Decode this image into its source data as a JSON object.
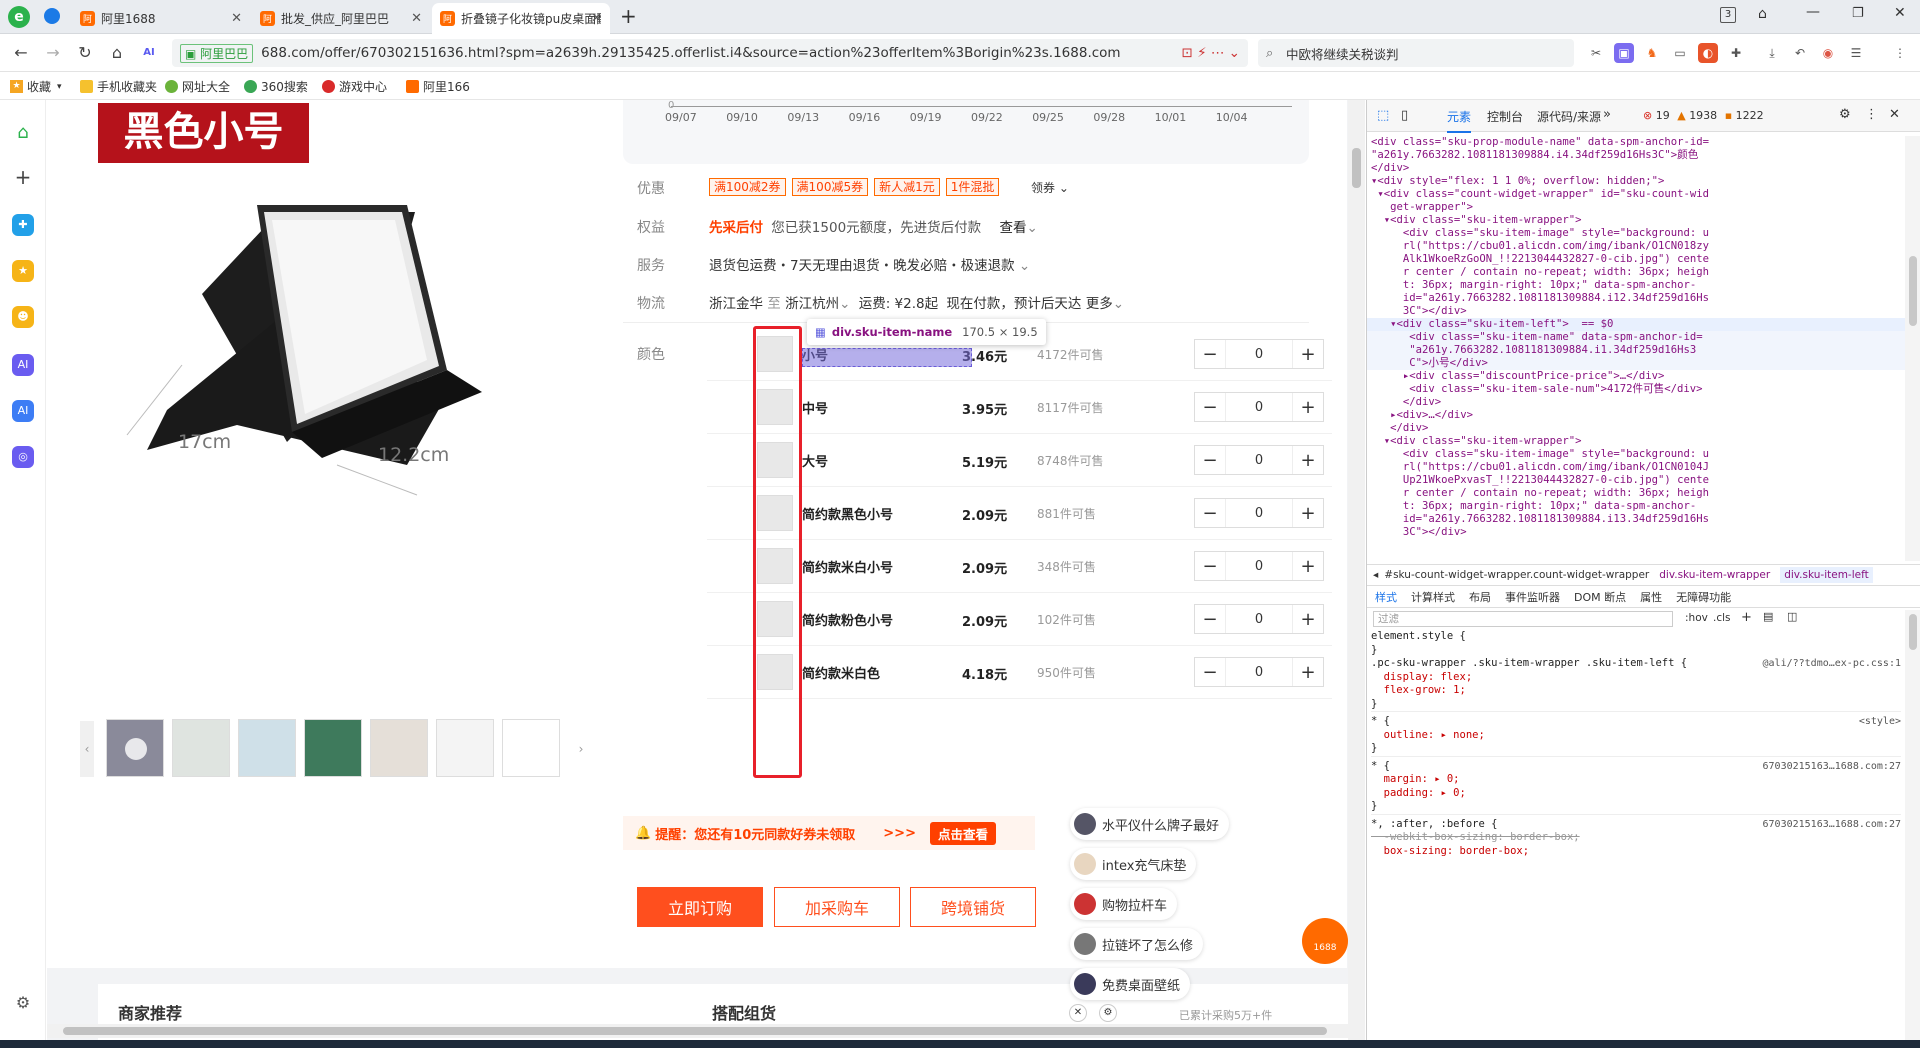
{
  "browser": {
    "tabs": [
      {
        "label": "阿里1688"
      },
      {
        "label": "批发_供应_阿里巴巴"
      },
      {
        "label": "折叠镜子化妆镜pu皮桌面翻盖"
      }
    ],
    "tab_count": "3",
    "url_site": "阿里巴巴",
    "url": "688.com/offer/670302151636.html?spm=a2639h.29135425.offerlist.i4&source=action%23offerItem%3Borigin%23s.1688.com",
    "search_text": "中欧将继续关税谈判",
    "bookmarks": [
      "收藏",
      "手机收藏夹",
      "网址大全",
      "360搜索",
      "游戏中心",
      "阿里166"
    ]
  },
  "product": {
    "variant_banner": "黑色小号",
    "dim_width": "17cm",
    "dim_height": "12.2cm",
    "chart_dates": [
      "09/07",
      "09/10",
      "09/13",
      "09/16",
      "09/19",
      "09/22",
      "09/25",
      "09/28",
      "10/01",
      "10/04"
    ],
    "chart_zero": "0",
    "youhui_label": "优惠",
    "promos": [
      "满100减2券",
      "满100减5券",
      "新人减1元",
      "1件混批"
    ],
    "coupon_link": "领券",
    "quanyi_label": "权益",
    "quanyi_strong": "先采后付",
    "quanyi_text": "您已获1500元额度，先进货后付款",
    "quanyi_link": "查看",
    "fuwu_label": "服务",
    "fuwu_text": "退货包运费・7天无理由退货・晚发必赔・极速退款",
    "wuliu_label": "物流",
    "wuliu_from": "浙江金华",
    "wuliu_to_word": "至",
    "wuliu_to": "浙江杭州",
    "wuliu_fee": "运费: ¥2.8起",
    "wuliu_eta": "现在付款，预计后天达",
    "wuliu_more": "更多",
    "color_label": "颜色",
    "tooltip_name": "div.sku-item-name",
    "tooltip_size": "170.5 × 19.5",
    "skus": [
      {
        "name": "小号",
        "price": "3.46元",
        "stock": "4172件可售",
        "qty": "0"
      },
      {
        "name": "中号",
        "price": "3.95元",
        "stock": "8117件可售",
        "qty": "0"
      },
      {
        "name": "大号",
        "price": "5.19元",
        "stock": "8748件可售",
        "qty": "0"
      },
      {
        "name": "简约款黑色小号",
        "price": "2.09元",
        "stock": "881件可售",
        "qty": "0"
      },
      {
        "name": "简约款米白小号",
        "price": "2.09元",
        "stock": "348件可售",
        "qty": "0"
      },
      {
        "name": "简约款粉色小号",
        "price": "2.09元",
        "stock": "102件可售",
        "qty": "0"
      },
      {
        "name": "简约款米白色",
        "price": "4.18元",
        "stock": "950件可售",
        "qty": "0"
      }
    ],
    "minus": "−",
    "plus": "+",
    "reminder_text": "提醒：您还有10元同款好券未领取",
    "reminder_arrows": ">>>",
    "reminder_btn": "点击查看",
    "btn_order": "立即订购",
    "btn_cart": "加采购车",
    "btn_cross": "跨境铺货",
    "section_left": "商家推荐",
    "section_right": "搭配组货",
    "float_items": [
      "水平仪什么牌子最好",
      "intex充气床垫",
      "购物拉杆车",
      "拉链坏了怎么修",
      "免费桌面壁纸"
    ],
    "bottom_note": "已累计采购5万+件",
    "logo_text": "1688"
  },
  "devtools": {
    "tabs": [
      "元素",
      "控制台",
      "源代码/来源"
    ],
    "errors": "19",
    "warnings": "1938",
    "info": "1222",
    "code_lines": [
      "<div class=\"sku-prop-module-name\" data-spm-anchor-id=",
      "\"a261y.7663282.1081181309884.i4.34df259d16Hs3C\">颜色",
      "</div>",
      "▾<div style=\"flex: 1 1 0%; overflow: hidden;\">",
      " ▾<div class=\"count-widget-wrapper\" id=\"sku-count-wid",
      "   get-wrapper\">",
      "  ▾<div class=\"sku-item-wrapper\">",
      "     <div class=\"sku-item-image\" style=\"background: u",
      "     rl(\"https://cbu01.alicdn.com/img/ibank/O1CN018zy",
      "     Alk1WkoeRzGoON_!!2213044432827-0-cib.jpg\") cente",
      "     r center / contain no-repeat; width: 36px; heigh",
      "     t: 36px; margin-right: 10px;\" data-spm-anchor-",
      "     id=\"a261y.7663282.1081181309884.i12.34df259d16Hs",
      "     3C\"></div>",
      "   ▾<div class=\"sku-item-left\">  == $0",
      "      <div class=\"sku-item-name\" data-spm-anchor-id=",
      "      \"a261y.7663282.1081181309884.i1.34df259d16Hs3",
      "      C\">小号</div>",
      "     ▸<div class=\"discountPrice-price\">…</div>",
      "      <div class=\"sku-item-sale-num\">4172件可售</div>",
      "     </div>",
      "   ▸<div>…</div>",
      "   </div>",
      "  ▾<div class=\"sku-item-wrapper\">",
      "     <div class=\"sku-item-image\" style=\"background: u",
      "     rl(\"https://cbu01.alicdn.com/img/ibank/O1CN0104J",
      "     Up21WkoePxvasT_!!2213044432827-0-cib.jpg\") cente",
      "     r center / contain no-repeat; width: 36px; heigh",
      "     t: 36px; margin-right: 10px;\" data-spm-anchor-",
      "     id=\"a261y.7663282.1081181309884.i13.34df259d16Hs",
      "     3C\"></div>"
    ],
    "breadcrumb": [
      "#sku-count-widget-wrapper.count-widget-wrapper",
      "div.sku-item-wrapper",
      "div.sku-item-left"
    ],
    "subtabs": [
      "样式",
      "计算样式",
      "布局",
      "事件监听器",
      "DOM 断点",
      "属性",
      "无障碍功能"
    ],
    "filter_placeholder": "过滤",
    "filter_hov": ":hov",
    "filter_cls": ".cls",
    "css_lines": [
      "element.style {",
      "}",
      ".pc-sku-wrapper .sku-item-wrapper .sku-item-left {",
      "  display: flex;",
      "  flex-grow: 1;",
      "}",
      "* {",
      "  outline: ▸ none;",
      "}",
      "* {",
      "  margin: ▸ 0;",
      "  padding: ▸ 0;",
      "}",
      "*, :after, :before {",
      "  -webkit-box-sizing: border-box;",
      "  box-sizing: border-box;"
    ],
    "css_sources": [
      "@ali/??tdmo…ex-pc.css:1",
      "<style>",
      "67030215163…1688.com:27",
      "67030215163…1688.com:27"
    ]
  }
}
